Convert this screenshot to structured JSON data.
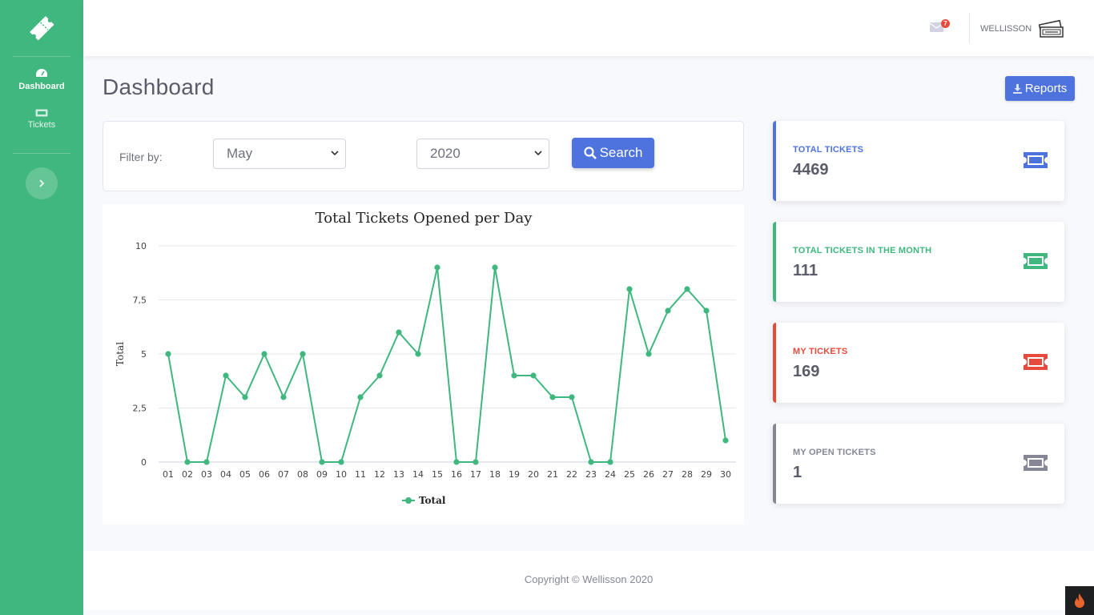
{
  "sidebar": {
    "items": [
      {
        "label": "Dashboard",
        "icon": "gauge-icon",
        "active": true
      },
      {
        "label": "Tickets",
        "icon": "ticket-icon",
        "active": false
      }
    ]
  },
  "topbar": {
    "mail_badge": "7",
    "username": "WELLISSON"
  },
  "page": {
    "title": "Dashboard",
    "reports_label": "Reports"
  },
  "filter": {
    "label": "Filter by:",
    "month": "May",
    "year": "2020",
    "search_label": "Search"
  },
  "stats": [
    {
      "title": "TOTAL TICKETS",
      "value": "4469",
      "color": "#4e73df"
    },
    {
      "title": "TOTAL TICKETS IN THE MONTH",
      "value": "111",
      "color": "#3fb77e"
    },
    {
      "title": "MY TICKETS",
      "value": "169",
      "color": "#e74a3b"
    },
    {
      "title": "MY OPEN TICKETS",
      "value": "1",
      "color": "#858796"
    }
  ],
  "footer": {
    "copyright": "Copyright © Wellisson 2020"
  },
  "chart_data": {
    "type": "line",
    "title": "Total Tickets Opened per Day",
    "xlabel": "",
    "ylabel": "Total",
    "categories": [
      "01",
      "02",
      "03",
      "04",
      "05",
      "06",
      "07",
      "08",
      "09",
      "10",
      "11",
      "12",
      "13",
      "14",
      "15",
      "16",
      "17",
      "18",
      "19",
      "20",
      "21",
      "22",
      "23",
      "24",
      "25",
      "26",
      "27",
      "28",
      "29",
      "30"
    ],
    "series": [
      {
        "name": "Total",
        "values": [
          5,
          0,
          0,
          4,
          3,
          5,
          3,
          5,
          0,
          0,
          3,
          4,
          6,
          5,
          9,
          0,
          0,
          9,
          4,
          4,
          3,
          3,
          0,
          0,
          8,
          5,
          7,
          8,
          7,
          1
        ],
        "color": "#3fb77e"
      }
    ],
    "yticks": [
      "0",
      "2,5",
      "5",
      "7,5",
      "10"
    ],
    "ylim": [
      0,
      10
    ],
    "grid": true,
    "legend": "bottom"
  }
}
